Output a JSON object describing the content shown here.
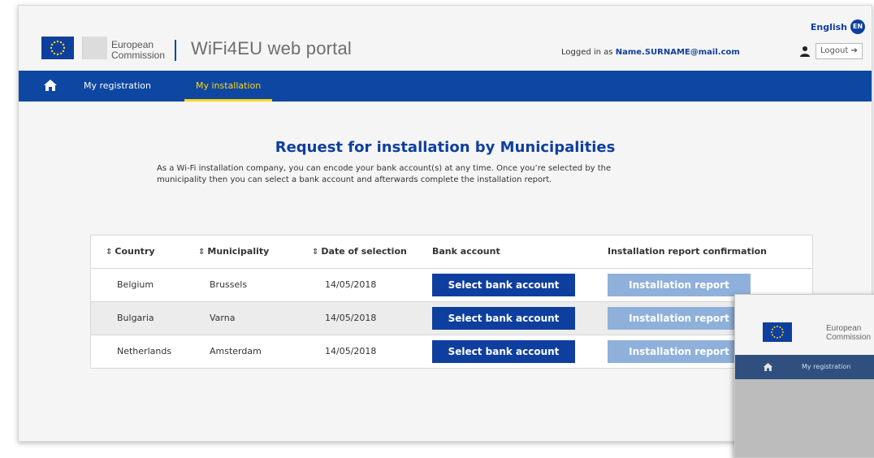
{
  "header": {
    "org_line1": "European",
    "org_line2": "Commission",
    "portal_title": "WiFi4EU web portal",
    "logged_in_prefix": "Logged in as",
    "user_email": "Name.SURNAME@mail.com",
    "language": "English",
    "language_code": "EN",
    "logout_label": "Logout"
  },
  "nav": {
    "items": [
      {
        "label": "My registration",
        "active": false
      },
      {
        "label": "My installation",
        "active": true
      }
    ]
  },
  "main": {
    "title": "Request for installation by Municipalities",
    "intro_line1": "As a Wi-Fi installation company, you can encode your bank account(s) at any time. Once you’re selected by the",
    "intro_line2": "municipality then you can select a bank account and afterwards complete the installation report."
  },
  "table": {
    "columns": [
      "Country",
      "Municipality",
      "Date of selection",
      "Bank account",
      "Installation report confirmation"
    ],
    "rows": [
      {
        "country": "Belgium",
        "municipality": "Brussels",
        "date": "14/05/2018",
        "bank_button": "Select bank account",
        "report_button": "Installation report"
      },
      {
        "country": "Bulgaria",
        "municipality": "Varna",
        "date": "14/05/2018",
        "bank_button": "Select bank account",
        "report_button": "Installation report"
      },
      {
        "country": "Netherlands",
        "municipality": "Amsterdam",
        "date": "14/05/2018",
        "bank_button": "Select bank account",
        "report_button": "Installation report"
      }
    ]
  },
  "inset": {
    "org_line1": "European",
    "org_line2": "Commission",
    "nav_label": "My registration"
  },
  "colors": {
    "brand_blue": "#0e47a1",
    "title_blue": "#0e3f9e",
    "active_tab": "#ffd617",
    "disabled_button": "#8fb0da"
  },
  "icons": {
    "home": "home-icon",
    "user": "user-icon",
    "logout": "logout-icon",
    "sort": "sort-icon",
    "flag": "eu-flag-icon"
  }
}
